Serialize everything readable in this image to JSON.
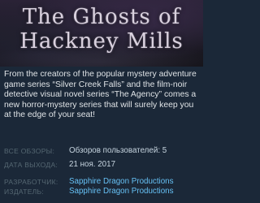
{
  "header": {
    "title_line1": "The Ghosts of",
    "title_line2": "Hackney Mills"
  },
  "description": "From the creators of the popular mystery adventure game series “Silver Creek Falls” and the film-noir detective visual novel series “The Agency” comes a new horror-mystery series that will surely keep you at the edge of your seat!",
  "info": {
    "reviews_label": "ВСЕ ОБЗОРЫ:",
    "reviews_value": "Обзоров пользователей: 5",
    "release_label": "ДАТА ВЫХОДА:",
    "release_value": "21 ноя. 2017",
    "developer_label": "РАЗРАБОТЧИК:",
    "developer_value": "Sapphire Dragon Productions",
    "publisher_label": "ИЗДАТЕЛЬ:",
    "publisher_value": "Sapphire Dragon Productions"
  },
  "colors": {
    "background": "#1b2838",
    "label": "#556772",
    "value": "#c6d4df",
    "link": "#66c0f4"
  }
}
